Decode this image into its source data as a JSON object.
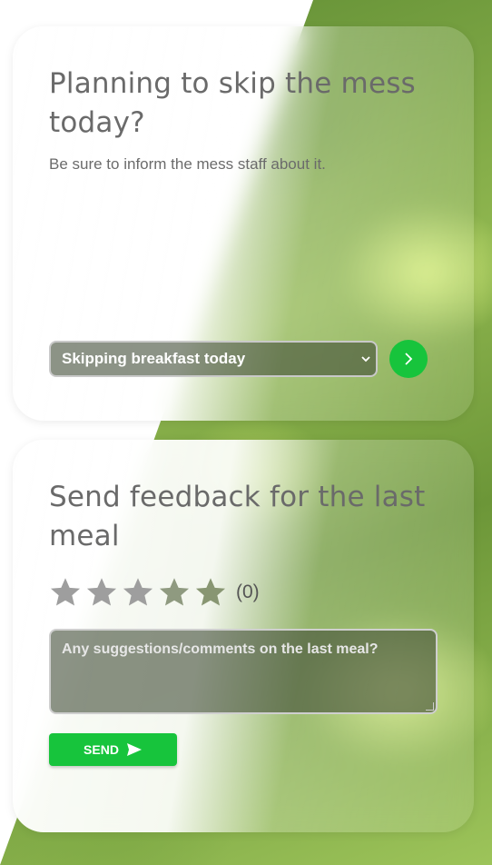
{
  "skip_card": {
    "title": "Planning to skip the mess today?",
    "subtitle": "Be sure to inform the mess staff about it.",
    "select_value": "Skipping breakfast today",
    "go_icon": "chevron-right-icon"
  },
  "feedback_card": {
    "title": "Send feedback for the last meal",
    "rating_count": "(0)",
    "rating_value": 0,
    "rating_max": 5,
    "comment_placeholder": "Any suggestions/comments on the last meal?",
    "send_label": "SEND",
    "send_icon": "send-icon"
  },
  "colors": {
    "accent": "#17c43c",
    "star_empty": "#9e9e9e"
  }
}
